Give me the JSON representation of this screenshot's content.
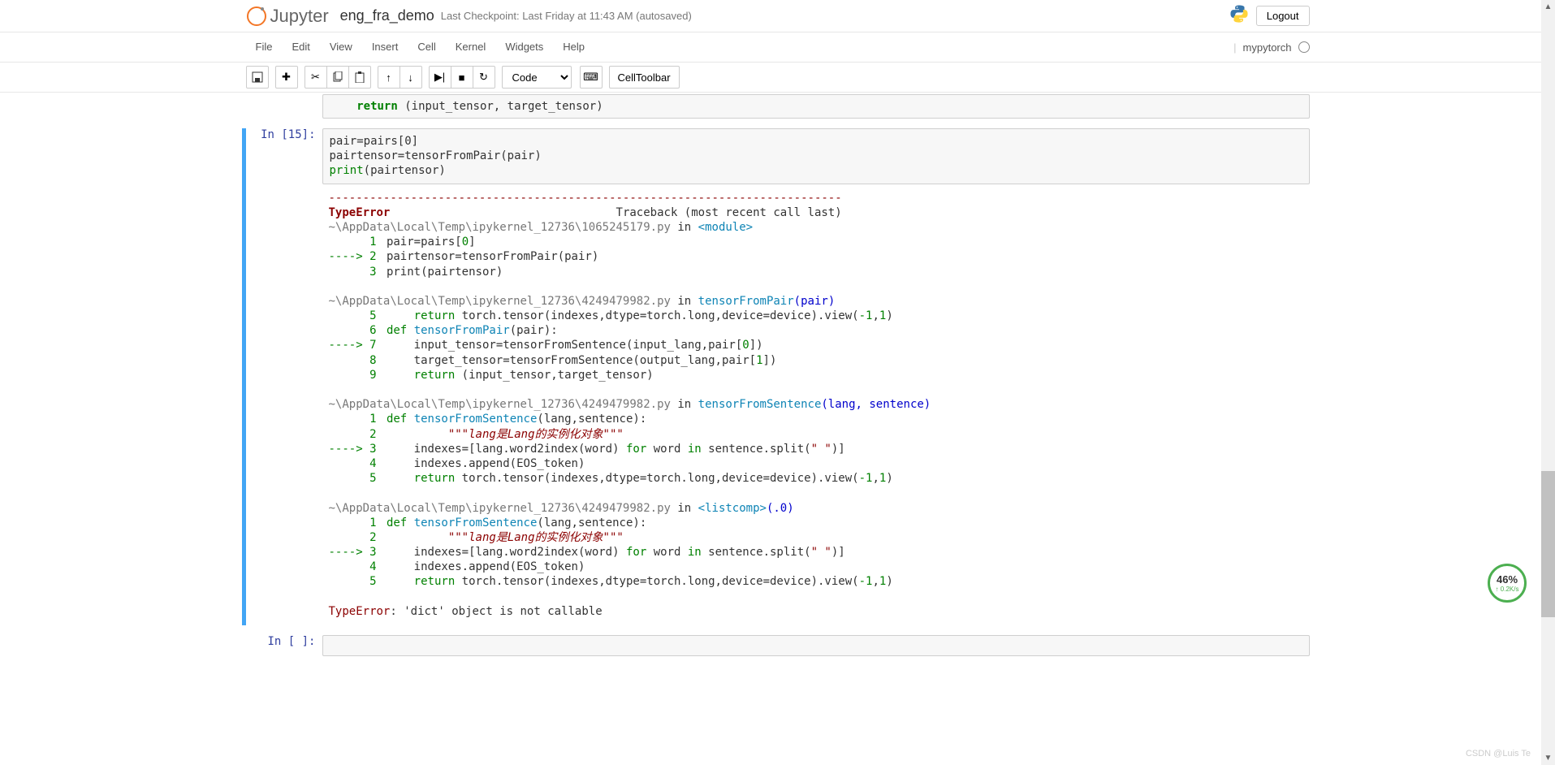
{
  "header": {
    "logo": "Jupyter",
    "notebook_name": "eng_fra_demo",
    "checkpoint": "Last Checkpoint: Last Friday at 11:43 AM (autosaved)",
    "logout": "Logout"
  },
  "menubar": {
    "items": [
      "File",
      "Edit",
      "View",
      "Insert",
      "Cell",
      "Kernel",
      "Widgets",
      "Help"
    ],
    "kernel_name": "mypytorch"
  },
  "toolbar": {
    "cell_type": "Code",
    "celltoolbar": "CellToolbar",
    "icons": {
      "save": "save-icon",
      "add": "plus-icon",
      "cut": "cut-icon",
      "copy": "copy-icon",
      "paste": "paste-icon",
      "up": "up-icon",
      "down": "down-icon",
      "run": "run-icon",
      "stop": "stop-icon",
      "restart": "restart-icon",
      "keyboard": "keyboard-icon"
    }
  },
  "prev_cell": {
    "code_line1_kw": "return",
    "code_line1_rest": " (input_tensor, target_tensor)"
  },
  "cell15": {
    "prompt": "In  [15]:",
    "code_lines": [
      "pair=pairs[0]",
      "pairtensor=tensorFromPair(pair)",
      "print(pairtensor)"
    ]
  },
  "output": {
    "dashes": "---------------------------------------------------------------------------",
    "error_name": "TypeError",
    "traceback_label": "Traceback (most recent call last)",
    "file1": {
      "path": "~\\AppData\\Local\\Temp\\ipykernel_12736\\1065245179.py",
      "in_txt": " in ",
      "module": "<module>",
      "l1_num": "1",
      "l1_a": " pair",
      "l1_eq": "=",
      "l1_b": "pairs",
      "l1_c": "[",
      "l1_d": "0",
      "l1_e": "]",
      "arrow": "----> ",
      "l2_num": "2",
      "l2_a": " pairtensor",
      "l2_eq": "=",
      "l2_b": "tensorFromPair",
      "l2_c": "(",
      "l2_d": "pair",
      "l2_e": ")",
      "l3_num": "3",
      "l3_a": " print",
      "l3_b": "(",
      "l3_c": "pairtensor",
      "l3_d": ")"
    },
    "file2": {
      "path": "~\\AppData\\Local\\Temp\\ipykernel_12736\\4249479982.py",
      "in_txt": " in ",
      "fn": "tensorFromPair",
      "args": "(pair)",
      "l5_num": "5",
      "l5_txt": "     return torch.tensor(indexes,dtype=torch.long,device=device).view(-1,1)",
      "l6_num": "6",
      "l6_txt": " def tensorFromPair(pair):",
      "arrow": "----> ",
      "l7_num": "7",
      "l7_txt": "     input_tensor=tensorFromSentence(input_lang,pair[0])",
      "l8_num": "8",
      "l8_txt": "     target_tensor=tensorFromSentence(output_lang,pair[1])",
      "l9_num": "9",
      "l9_txt": "     return (input_tensor,target_tensor)"
    },
    "file3": {
      "path": "~\\AppData\\Local\\Temp\\ipykernel_12736\\4249479982.py",
      "in_txt": " in ",
      "fn": "tensorFromSentence",
      "args": "(lang, sentence)",
      "l1_num": "1",
      "l1_txt": " def tensorFromSentence(lang,sentence):",
      "l2_num": "2",
      "l2_txt": "     \"\"\"lang是Lang的实例化对象\"\"\"",
      "arrow": "----> ",
      "l3_num": "3",
      "l3_txt": "     indexes=[lang.word2index(word) for word in sentence.split(\" \")]",
      "l4_num": "4",
      "l4_txt": "     indexes.append(EOS_token)",
      "l5_num": "5",
      "l5_txt": "     return torch.tensor(indexes,dtype=torch.long,device=device).view(-1,1)"
    },
    "file4": {
      "path": "~\\AppData\\Local\\Temp\\ipykernel_12736\\4249479982.py",
      "in_txt": " in ",
      "fn": "<listcomp>",
      "args": "(.0)",
      "l1_num": "1",
      "l1_txt": " def tensorFromSentence(lang,sentence):",
      "l2_num": "2",
      "l2_txt": "     \"\"\"lang是Lang的实例化对象\"\"\"",
      "arrow": "----> ",
      "l3_num": "3",
      "l3_txt": "     indexes=[lang.word2index(word) for word in sentence.split(\" \")]",
      "l4_num": "4",
      "l4_txt": "     indexes.append(EOS_token)",
      "l5_num": "5",
      "l5_txt": "     return torch.tensor(indexes,dtype=torch.long,device=device).view(-1,1)"
    },
    "final": {
      "name": "TypeError",
      "msg": ": 'dict' object is not callable"
    }
  },
  "next_cell": {
    "prompt": "In  [ ]:"
  },
  "widget": {
    "pct": "46%",
    "sub": "↑ 0.2K/s"
  },
  "watermark": "CSDN @Luis Te"
}
